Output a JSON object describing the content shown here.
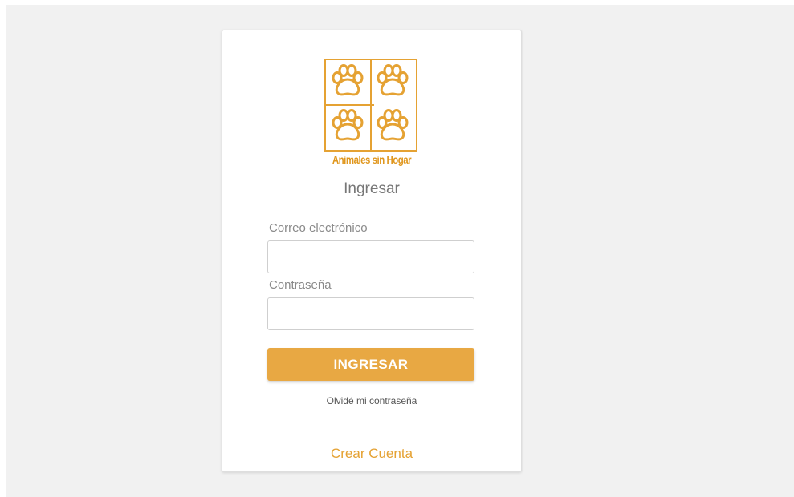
{
  "logo": {
    "text": "Animales sin Hogar",
    "icon": "paw-icon",
    "color": "#e5a233"
  },
  "login": {
    "heading": "Ingresar",
    "email_label": "Correo electrónico",
    "email_value": "",
    "email_placeholder": "",
    "password_label": "Contraseña",
    "password_value": "",
    "password_placeholder": "",
    "submit_label": "INGRESAR",
    "forgot_link": "Olvidé mi contraseña",
    "create_account_link": "Crear Cuenta"
  },
  "colors": {
    "accent": "#e8a843",
    "link": "#e5a233",
    "background": "#f1f1f1"
  }
}
